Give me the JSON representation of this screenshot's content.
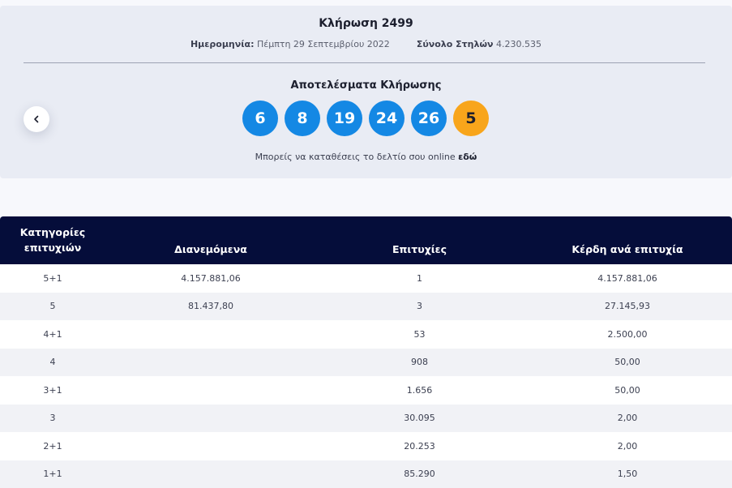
{
  "draw": {
    "title": "Κλήρωση 2499",
    "date_label": "Ημερομηνία:",
    "date_value": "Πέμπτη 29 Σεπτεμβρίου 2022",
    "columns_label": "Σύνολο Στηλών",
    "columns_value": "4.230.535",
    "results_title": "Αποτελέσματα Κλήρωσης",
    "numbers": [
      "6",
      "8",
      "19",
      "24",
      "26"
    ],
    "joker": "5",
    "online_text": "Μπορείς να καταθέσεις το δελτίο σου online ",
    "online_link": "εδώ"
  },
  "colors": {
    "ball": "#1488e4",
    "joker": "#f8a51b",
    "header": "#050d3a"
  },
  "table": {
    "headers": {
      "category_line1": "Κατηγορίες",
      "category_line2": "επιτυχιών",
      "distributed": "Διανεμόμενα",
      "winners": "Επιτυχίες",
      "prize": "Κέρδη ανά επιτυχία"
    },
    "rows": [
      {
        "category": "5+1",
        "distributed": "4.157.881,06",
        "winners": "1",
        "prize": "4.157.881,06"
      },
      {
        "category": "5",
        "distributed": "81.437,80",
        "winners": "3",
        "prize": "27.145,93"
      },
      {
        "category": "4+1",
        "distributed": "",
        "winners": "53",
        "prize": "2.500,00"
      },
      {
        "category": "4",
        "distributed": "",
        "winners": "908",
        "prize": "50,00"
      },
      {
        "category": "3+1",
        "distributed": "",
        "winners": "1.656",
        "prize": "50,00"
      },
      {
        "category": "3",
        "distributed": "",
        "winners": "30.095",
        "prize": "2,00"
      },
      {
        "category": "2+1",
        "distributed": "",
        "winners": "20.253",
        "prize": "2,00"
      },
      {
        "category": "1+1",
        "distributed": "",
        "winners": "85.290",
        "prize": "1,50"
      }
    ]
  }
}
